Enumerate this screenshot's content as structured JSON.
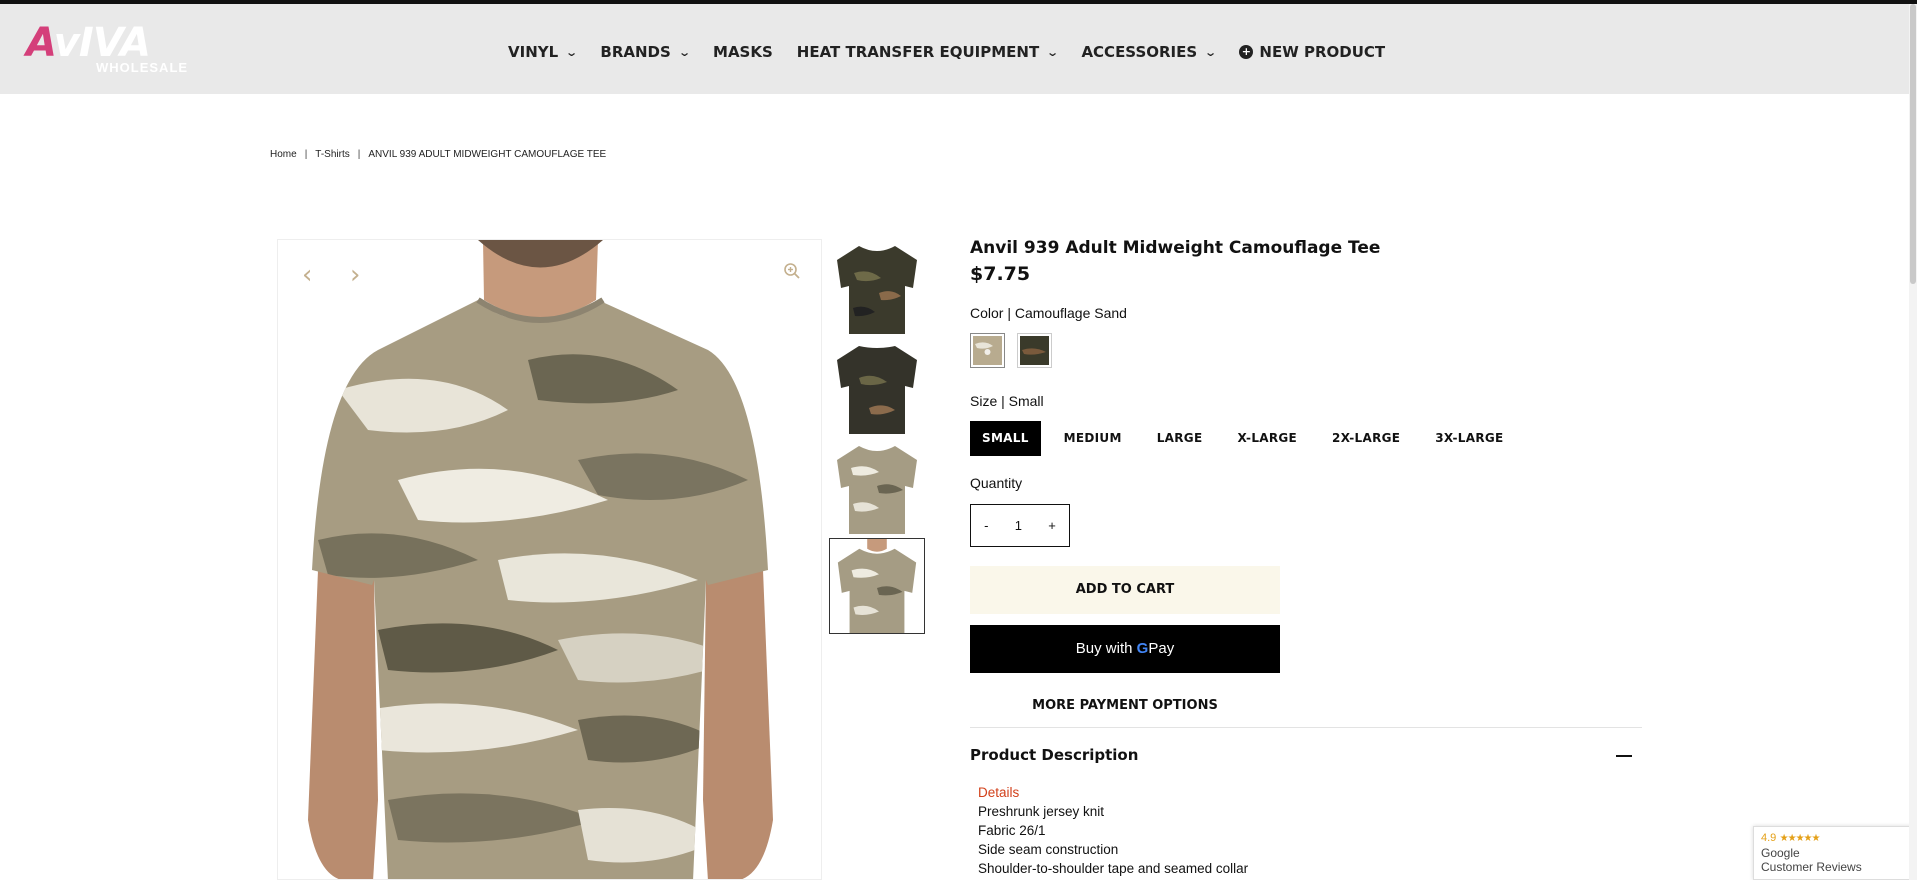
{
  "header": {
    "logo_text_a": "A",
    "logo_text_rest": "vIVA",
    "logo_sub": "WHOLESALE",
    "nav": [
      {
        "label": "VINYL",
        "dropdown": true
      },
      {
        "label": "BRANDS",
        "dropdown": true
      },
      {
        "label": "MASKS",
        "dropdown": false
      },
      {
        "label": "HEAT TRANSFER EQUIPMENT",
        "dropdown": true
      },
      {
        "label": "ACCESSORIES",
        "dropdown": true
      },
      {
        "label": "NEW PRODUCT",
        "dropdown": false,
        "icon": "plus-circle-icon"
      }
    ]
  },
  "breadcrumb": {
    "home": "Home",
    "category": "T-Shirts",
    "current": "ANVIL 939 ADULT MIDWEIGHT CAMOUFLAGE TEE",
    "separator": "|"
  },
  "product": {
    "title": "Anvil 939 Adult Midweight Camouflage Tee",
    "price": "$7.75",
    "color_label": "Color | Camouflage Sand",
    "colors": [
      {
        "name": "Camouflage Sand",
        "hex": "#b8ab8f",
        "selected": true
      },
      {
        "name": "Camouflage Green",
        "hex": "#3a3a2a",
        "selected": false
      }
    ],
    "size_label": "Size | Small",
    "sizes": [
      "SMALL",
      "MEDIUM",
      "LARGE",
      "X-LARGE",
      "2X-LARGE",
      "3X-LARGE"
    ],
    "selected_size": "SMALL",
    "quantity_label": "Quantity",
    "quantity": "1",
    "qty_minus": "-",
    "qty_plus": "+",
    "add_to_cart": "ADD TO CART",
    "gpay_prefix": "Buy with",
    "gpay_g": "G",
    "gpay_suffix": "Pay",
    "more_payment": "MORE PAYMENT OPTIONS",
    "description_heading": "Product Description",
    "details_label": "Details",
    "details": [
      "Preshrunk jersey knit",
      "Fabric 26/1",
      "Side seam construction",
      "Shoulder-to-shoulder tape and seamed collar"
    ]
  },
  "gallery": {
    "prev_icon": "chevron-left-icon",
    "next_icon": "chevron-right-icon",
    "zoom_icon": "zoom-in-icon",
    "thumbnails": [
      {
        "variant": "green-front",
        "active": false
      },
      {
        "variant": "green-back",
        "active": false
      },
      {
        "variant": "sand-front",
        "active": false
      },
      {
        "variant": "sand-model",
        "active": true
      }
    ]
  },
  "reviews": {
    "score": "4.9",
    "stars": "★★★★★",
    "source": "Google",
    "label": "Customer Reviews"
  },
  "colors": {
    "header_bg": "#e9e9e9",
    "logo_accent": "#d43f7a",
    "details_red": "#d2401a",
    "add_to_cart_bg": "#faf7ea",
    "arrow_tan": "#c4b08e"
  }
}
